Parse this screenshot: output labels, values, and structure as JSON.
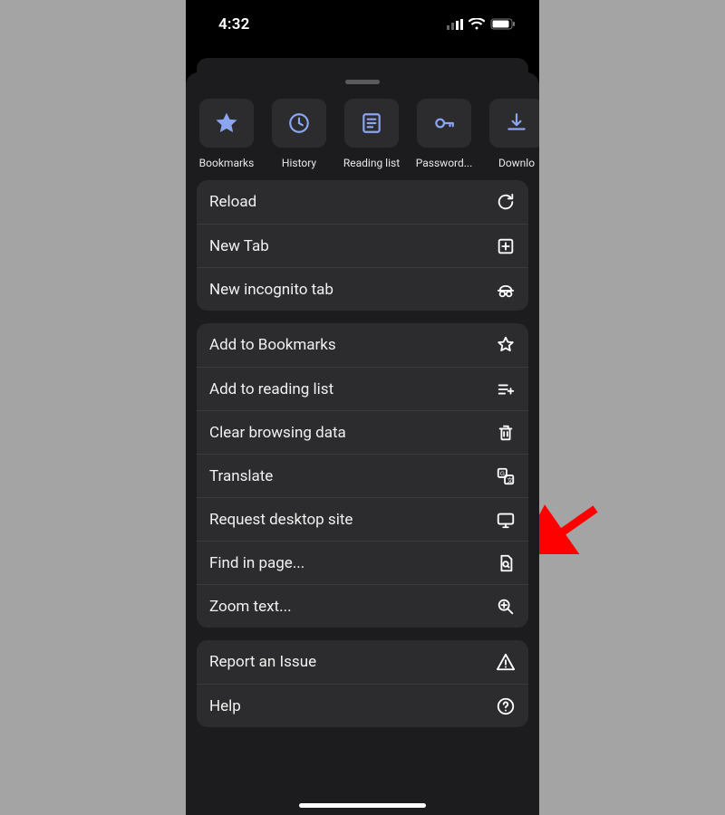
{
  "statusbar": {
    "time": "4:32"
  },
  "shortcuts": [
    {
      "label": "Bookmarks",
      "icon": "star-icon"
    },
    {
      "label": "History",
      "icon": "history-icon"
    },
    {
      "label": "Reading list",
      "icon": "reading-list-icon"
    },
    {
      "label": "Password...",
      "icon": "key-icon"
    },
    {
      "label": "Downlo",
      "icon": "download-icon"
    }
  ],
  "groups": [
    [
      {
        "label": "Reload",
        "icon": "reload-icon",
        "name": "menu-reload"
      },
      {
        "label": "New Tab",
        "icon": "new-tab-icon",
        "name": "menu-new-tab"
      },
      {
        "label": "New incognito tab",
        "icon": "incognito-icon",
        "name": "menu-new-incognito"
      }
    ],
    [
      {
        "label": "Add to Bookmarks",
        "icon": "star-outline-icon",
        "name": "menu-add-bookmarks"
      },
      {
        "label": "Add to reading list",
        "icon": "add-reading-list-icon",
        "name": "menu-add-reading-list"
      },
      {
        "label": "Clear browsing data",
        "icon": "trash-icon",
        "name": "menu-clear-browsing-data"
      },
      {
        "label": "Translate",
        "icon": "translate-icon",
        "name": "menu-translate"
      },
      {
        "label": "Request desktop site",
        "icon": "desktop-icon",
        "name": "menu-request-desktop-site"
      },
      {
        "label": "Find in page...",
        "icon": "find-in-page-icon",
        "name": "menu-find-in-page"
      },
      {
        "label": "Zoom text...",
        "icon": "zoom-in-icon",
        "name": "menu-zoom-text"
      }
    ],
    [
      {
        "label": "Report an Issue",
        "icon": "warning-icon",
        "name": "menu-report-issue"
      },
      {
        "label": "Help",
        "icon": "help-icon",
        "name": "menu-help"
      }
    ]
  ],
  "annotation": {
    "arrow_target": "menu-request-desktop-site"
  }
}
